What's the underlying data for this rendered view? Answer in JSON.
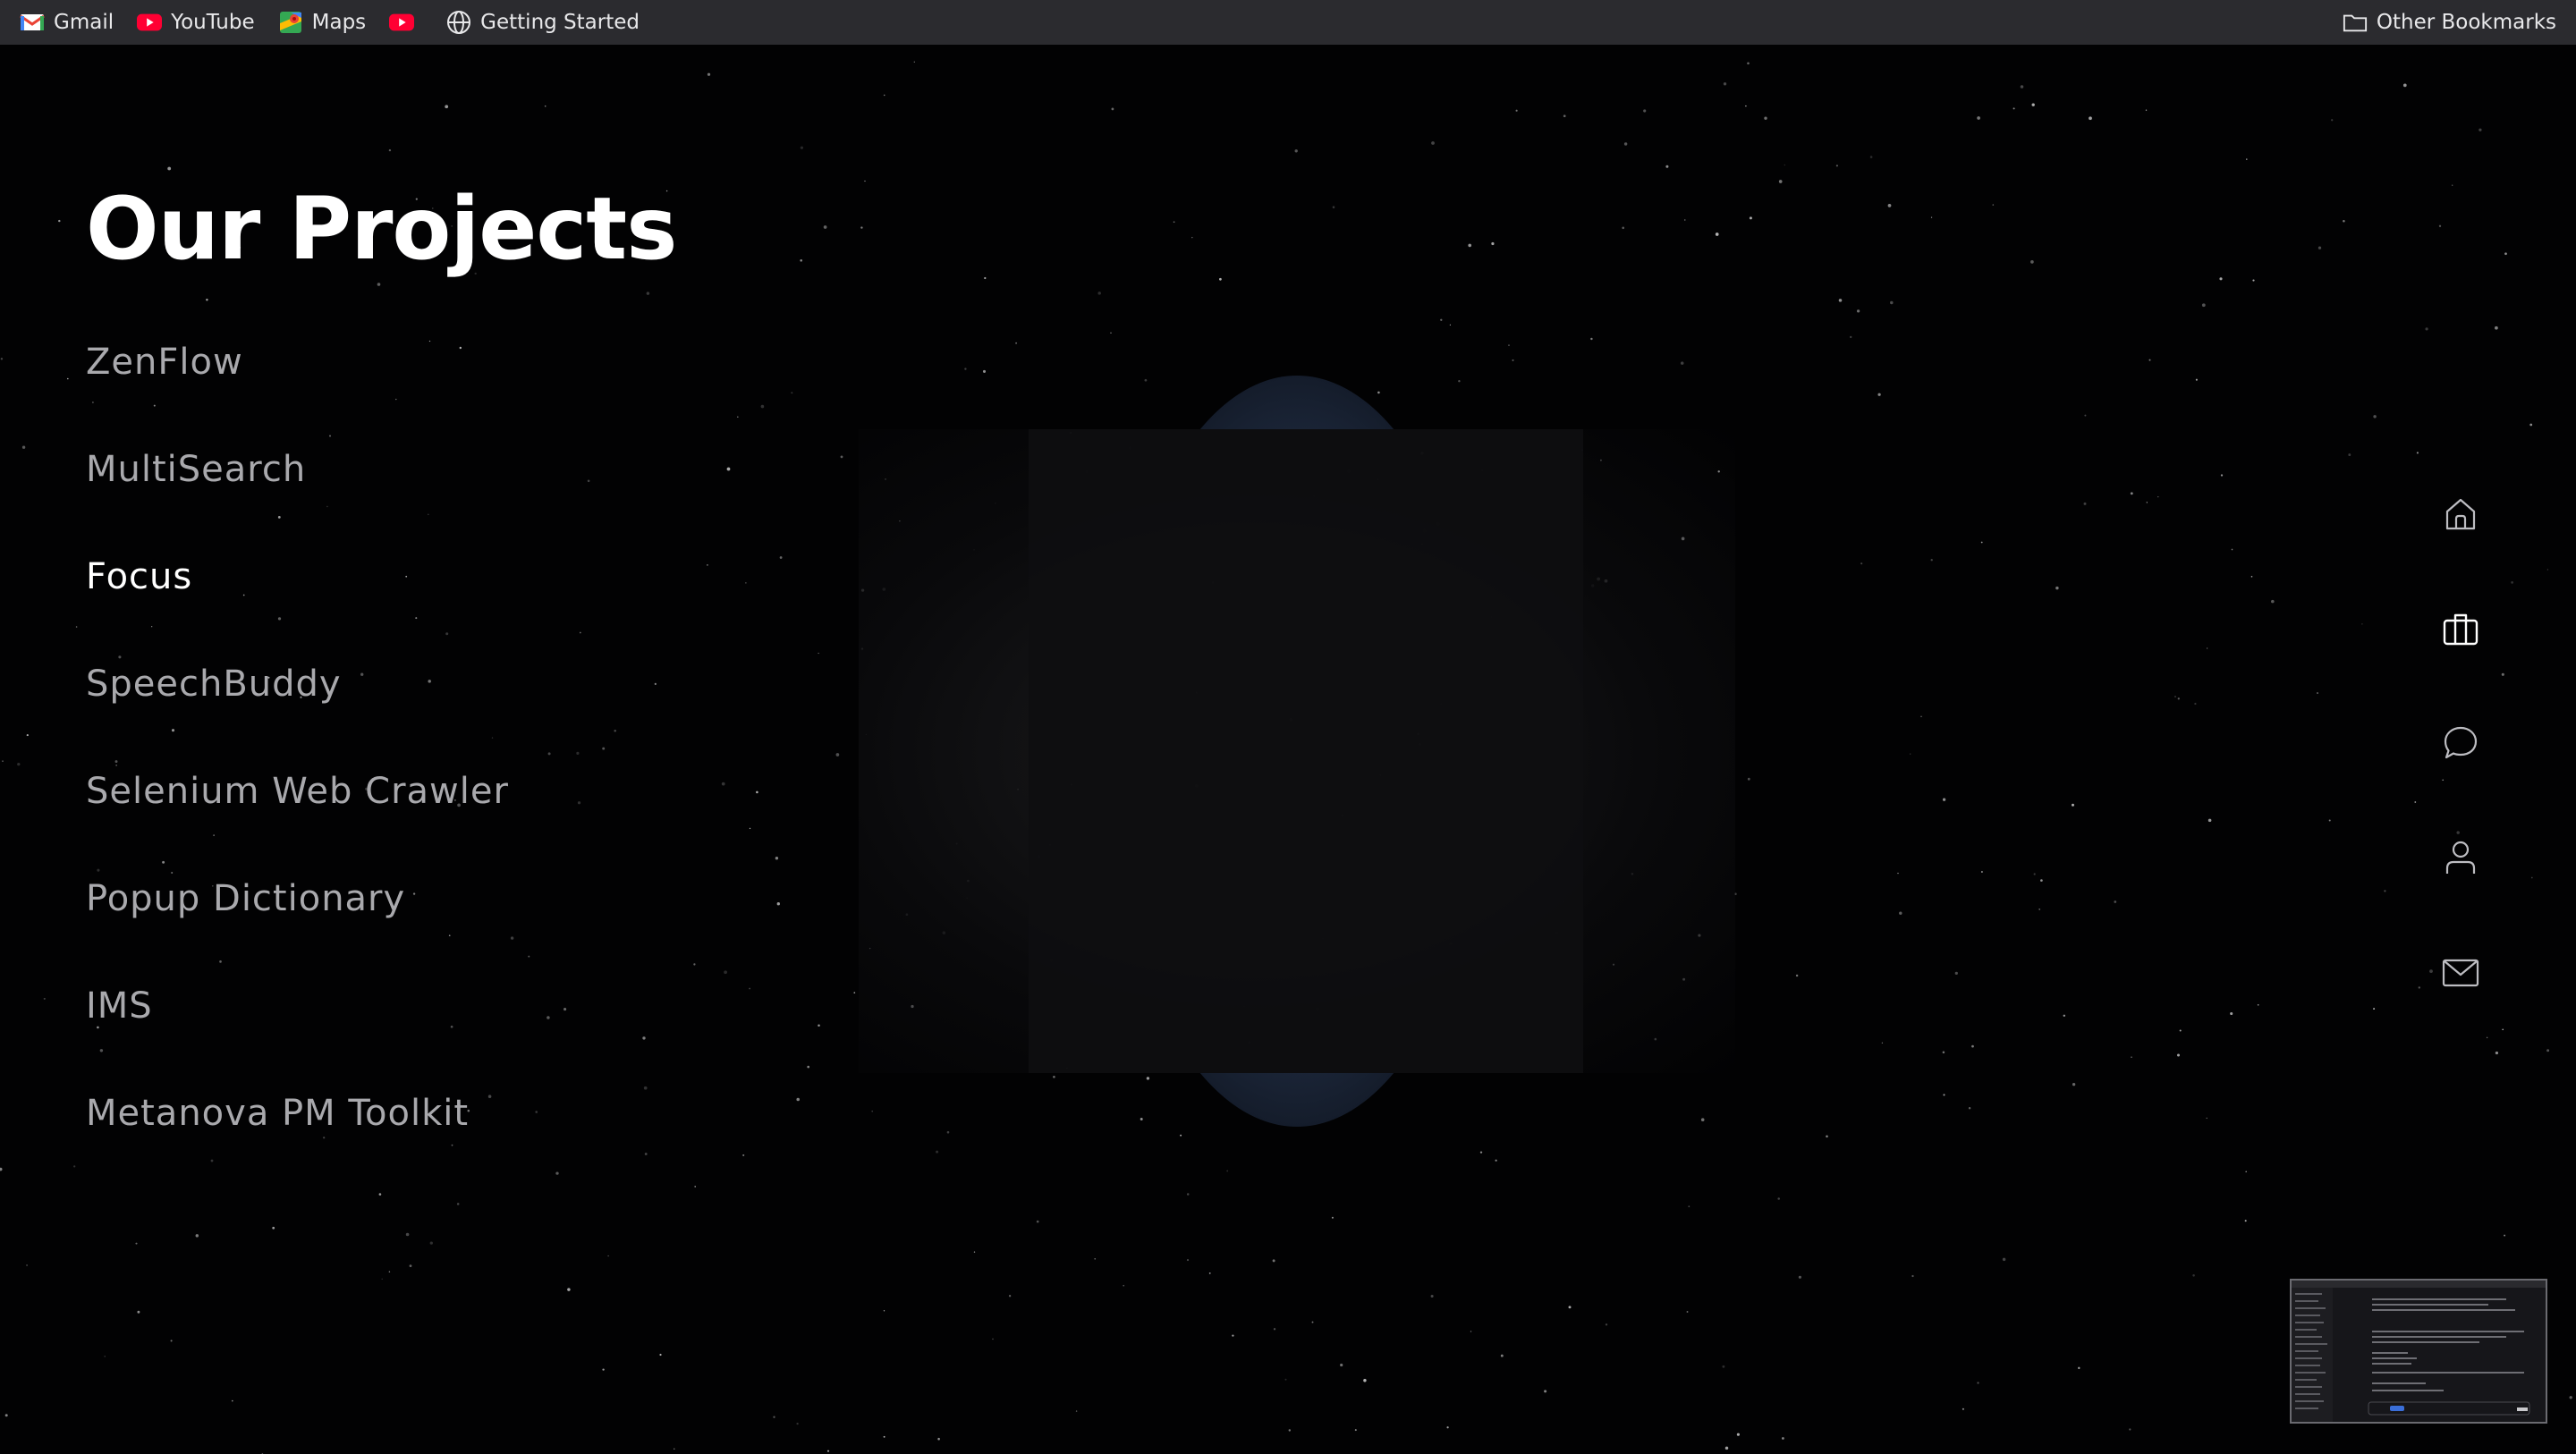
{
  "bookmarks_bar": {
    "items": [
      {
        "label": "Gmail",
        "icon": "gmail-icon"
      },
      {
        "label": "YouTube",
        "icon": "youtube-icon"
      },
      {
        "label": "Maps",
        "icon": "maps-icon"
      },
      {
        "label": "",
        "icon": "youtube-icon"
      },
      {
        "label": "Getting Started",
        "icon": "globe-icon"
      }
    ],
    "other_bookmarks": {
      "label": "Other Bookmarks",
      "icon": "folder-icon"
    }
  },
  "main": {
    "title": "Our Projects",
    "projects": [
      {
        "label": "ZenFlow",
        "active": false
      },
      {
        "label": "MultiSearch",
        "active": false
      },
      {
        "label": "Focus",
        "active": true
      },
      {
        "label": "SpeechBuddy",
        "active": false
      },
      {
        "label": "Selenium Web Crawler",
        "active": false
      },
      {
        "label": "Popup Dictionary",
        "active": false
      },
      {
        "label": "IMS",
        "active": false
      },
      {
        "label": "Metanova PM Toolkit",
        "active": false
      }
    ]
  },
  "side_nav": {
    "items": [
      {
        "name": "home",
        "icon": "home-icon"
      },
      {
        "name": "projects",
        "icon": "briefcase-icon"
      },
      {
        "name": "chat",
        "icon": "chat-bubble-icon"
      },
      {
        "name": "about",
        "icon": "user-icon"
      },
      {
        "name": "contact",
        "icon": "mail-icon"
      }
    ]
  },
  "colors": {
    "background": "#020203",
    "bookmarks_bar": "#2b2b2f",
    "text_primary": "#ffffff",
    "text_muted": "#a9a9ad",
    "youtube_red": "#ff0033"
  }
}
